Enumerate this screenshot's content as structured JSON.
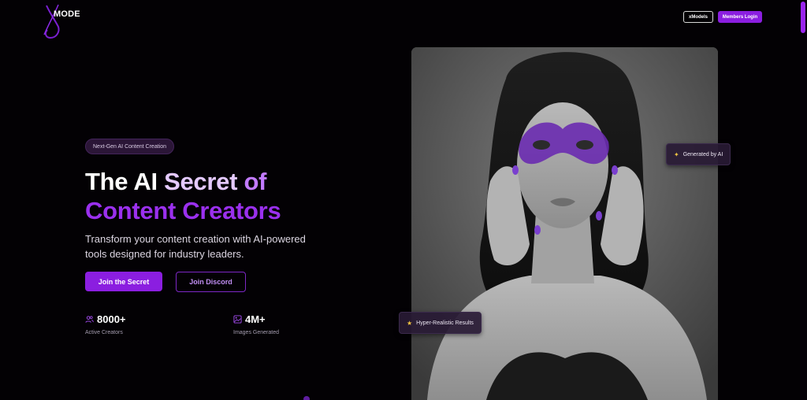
{
  "brand": {
    "logo_text": "MODE",
    "accent": "#8b1ee0"
  },
  "nav": {
    "xmodels_label": "xModels",
    "login_label": "Members Login"
  },
  "hero": {
    "badge": "Next-Gen AI Content Creation",
    "headline_word1": "The AI",
    "headline_word2": "Secret",
    "headline_word3": "of",
    "headline_line2": "Content Creators",
    "subtitle": "Transform your content creation with AI-powered tools designed for industry leaders.",
    "primary_cta": "Join the Secret",
    "secondary_cta": "Join Discord"
  },
  "stats": [
    {
      "icon": "users-icon",
      "value": "8000+",
      "label": "Active Creators"
    },
    {
      "icon": "image-icon",
      "value": "4M+",
      "label": "Images Generated"
    }
  ],
  "image_cards": {
    "generated": "Generated by AI",
    "hyper": "Hyper-Realistic Results"
  }
}
